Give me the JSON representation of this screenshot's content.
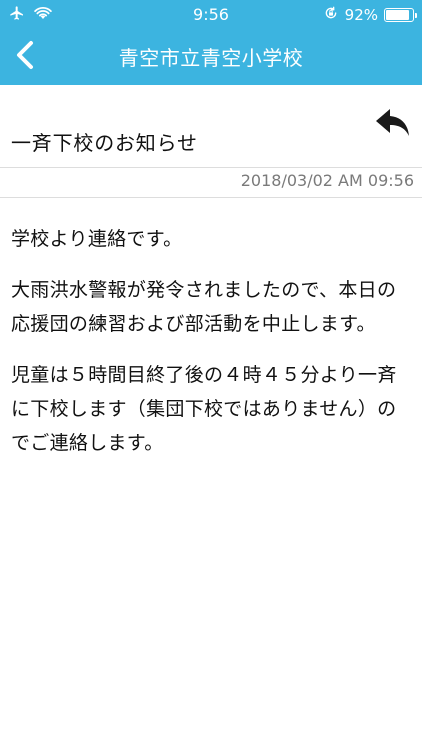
{
  "status_bar": {
    "time": "9:56",
    "battery_percent_label": "92%",
    "battery_level": 0.92
  },
  "nav": {
    "title": "青空市立青空小学校"
  },
  "message": {
    "subject": "一斉下校のお知らせ",
    "timestamp": "2018/03/02 AM 09:56",
    "paragraphs": [
      "学校より連絡です。",
      "大雨洪水警報が発令されましたので、本日の応援団の練習および部活動を中止します。",
      "児童は５時間目終了後の４時４５分より一斉に下校します（集団下校ではありません）のでご連絡します。"
    ]
  },
  "colors": {
    "header_bg": "#3cb4e0",
    "header_text": "#ffffff",
    "timestamp_text": "#7a7a7a"
  },
  "icons": {
    "airplane": "airplane-icon",
    "wifi": "wifi-icon",
    "orientation_lock": "orientation-lock-icon",
    "battery": "battery-icon",
    "back": "chevron-left-icon",
    "reply": "reply-arrow-icon"
  }
}
